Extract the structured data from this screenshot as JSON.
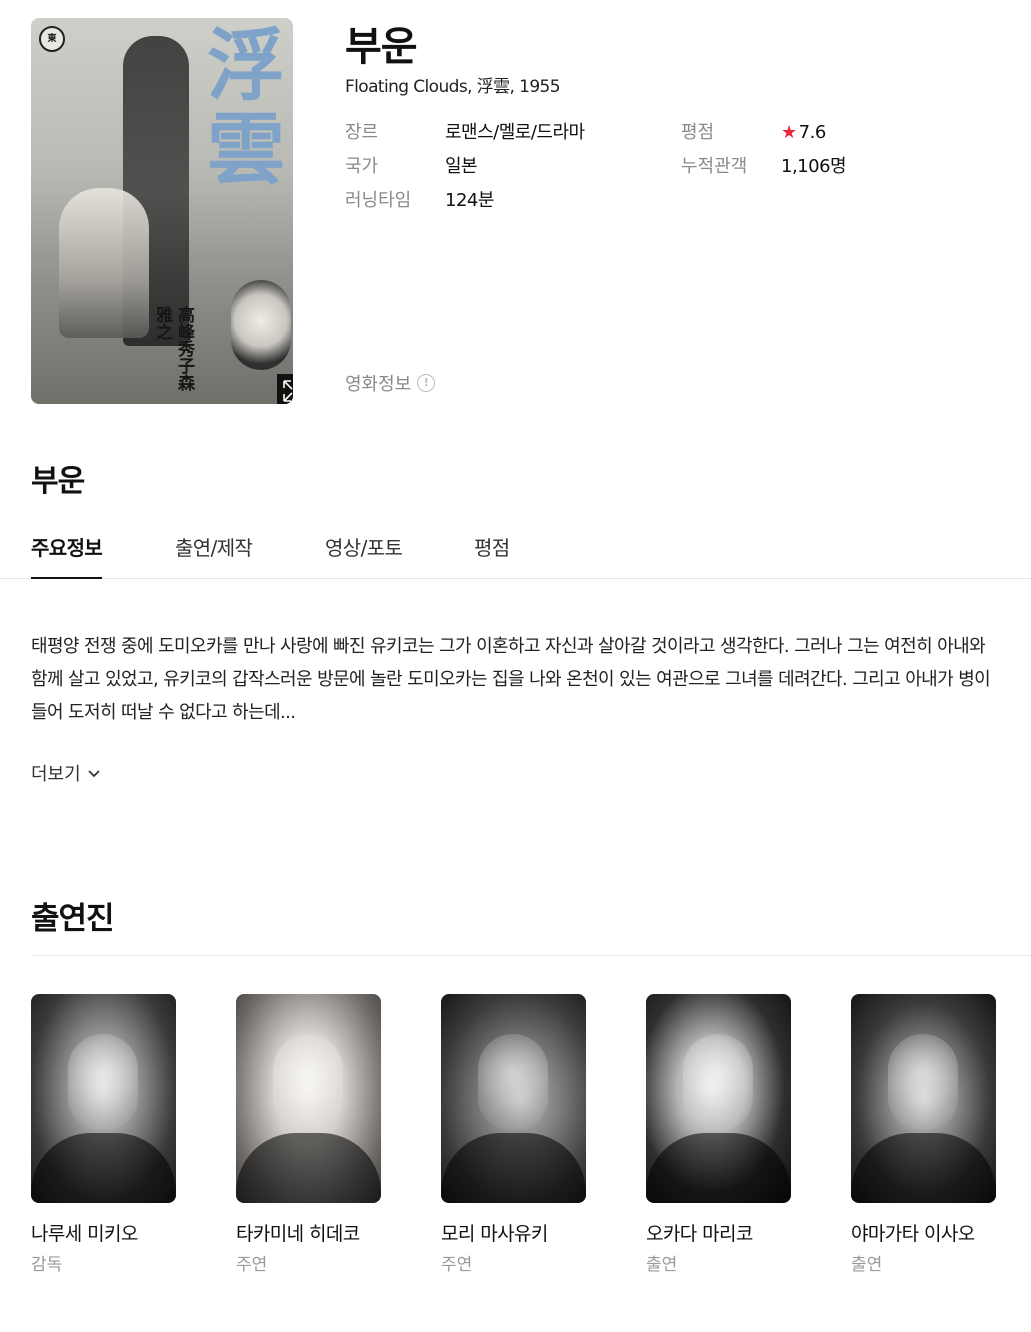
{
  "poster": {
    "title_glyphs": "浮雲",
    "logo_text": "東",
    "credits": "高峰秀子森雅之"
  },
  "movie": {
    "title": "부운",
    "subtitle": "Floating Clouds, 浮雲, 1955",
    "info": {
      "genre_label": "장르",
      "genre_value": "로맨스/멜로/드라마",
      "country_label": "국가",
      "country_value": "일본",
      "runtime_label": "러닝타임",
      "runtime_value": "124분",
      "rating_label": "평점",
      "rating_value": "7.6",
      "audience_label": "누적관객",
      "audience_value": "1,106명"
    },
    "movie_info_link": "영화정보"
  },
  "section": {
    "title": "부운"
  },
  "tabs": [
    {
      "label": "주요정보",
      "active": true
    },
    {
      "label": "출연/제작",
      "active": false
    },
    {
      "label": "영상/포토",
      "active": false
    },
    {
      "label": "평점",
      "active": false
    }
  ],
  "synopsis": {
    "text": "태평양 전쟁 중에 도미오카를 만나 사랑에 빠진 유키코는 그가 이혼하고 자신과 살아갈 것이라고 생각한다. 그러나 그는 여전히 아내와 함께 살고 있었고, 유키코의 갑작스러운 방문에 놀란 도미오카는 집을 나와 온천이 있는 여관으로 그녀를 데려간다. 그리고 아내가 병이 들어 도저히 떠날 수 없다고 하는데...",
    "more_label": "더보기"
  },
  "cast": {
    "title": "출연진",
    "members": [
      {
        "name": "나루세 미키오",
        "role": "감독"
      },
      {
        "name": "타카미네 히데코",
        "role": "주연"
      },
      {
        "name": "모리 마사유키",
        "role": "주연"
      },
      {
        "name": "오카다 마리코",
        "role": "출연"
      },
      {
        "name": "야마가타 이사오",
        "role": "출연"
      }
    ]
  },
  "colors": {
    "rating_star": "#e8263b",
    "muted_text": "#8a8a8a",
    "poster_title": "#7fa3c8"
  },
  "icons": {
    "rating": "star-icon",
    "expand": "expand-icon",
    "info": "info-circle-icon",
    "more": "chevron-down-icon"
  }
}
